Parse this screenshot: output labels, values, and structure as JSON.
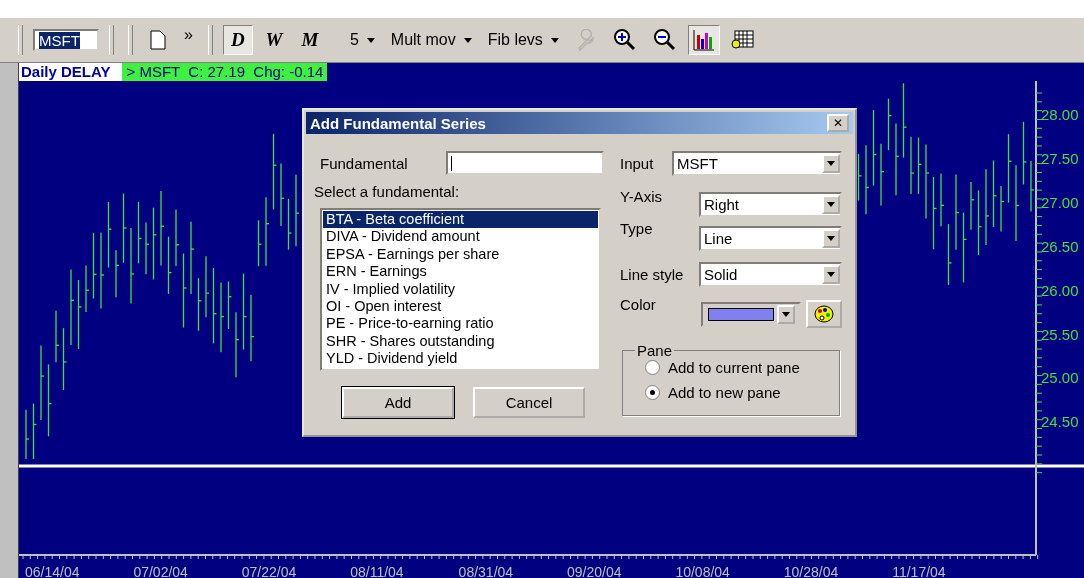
{
  "toolbar": {
    "symbol": "MSFT",
    "overflow": "»",
    "periods": [
      {
        "label": "D",
        "selected": true
      },
      {
        "label": "W",
        "selected": false
      },
      {
        "label": "M",
        "selected": false
      }
    ],
    "dropdowns": [
      {
        "label": "5"
      },
      {
        "label": "Mult mov"
      },
      {
        "label": "Fib levs"
      }
    ],
    "tools": [
      {
        "kind": "wrench",
        "disabled": true,
        "selected": false
      },
      {
        "kind": "zoom-in",
        "disabled": false,
        "selected": false
      },
      {
        "kind": "zoom-out",
        "disabled": false,
        "selected": false
      },
      {
        "kind": "bars",
        "disabled": false,
        "selected": true
      },
      {
        "kind": "grid",
        "disabled": false,
        "selected": false
      }
    ]
  },
  "chart": {
    "title": "Daily DELAY",
    "quote": "> MSFT  C: 27.19  Chg: -0.14",
    "y_labels": [
      "28.00",
      "27.50",
      "27.00",
      "26.50",
      "26.00",
      "25.50",
      "25.00",
      "24.50"
    ],
    "x_labels": [
      "06/14/04",
      "07/02/04",
      "07/22/04",
      "08/11/04",
      "08/31/04",
      "09/20/04",
      "10/08/04",
      "10/28/04",
      "11/17/04"
    ]
  },
  "dialog": {
    "title": "Add Fundamental Series",
    "close": "✕",
    "fundamental_label": "Fundamental",
    "list_label": "Select a fundamental:",
    "items": [
      {
        "label": "BTA - Beta coefficient",
        "selected": true
      },
      {
        "label": "DIVA - Dividend amount",
        "selected": false
      },
      {
        "label": "EPSA - Earnings per share",
        "selected": false
      },
      {
        "label": "ERN - Earnings",
        "selected": false
      },
      {
        "label": "IV - Implied volatility",
        "selected": false
      },
      {
        "label": "OI - Open interest",
        "selected": false
      },
      {
        "label": "PE - Price-to-earning ratio",
        "selected": false
      },
      {
        "label": "SHR - Shares outstanding",
        "selected": false
      },
      {
        "label": "YLD - Dividend yield",
        "selected": false
      }
    ],
    "buttons": [
      {
        "label": "Add",
        "default": true
      },
      {
        "label": "Cancel",
        "default": false
      }
    ],
    "combos": [
      {
        "label": "Input",
        "value": "MSFT"
      },
      {
        "label": "Y-Axis",
        "value": "Right"
      },
      {
        "label": "Type",
        "value": "Line"
      },
      {
        "label": "Line style",
        "value": "Solid"
      }
    ],
    "color": {
      "label": "Color",
      "color": "#8080f0"
    },
    "pane": {
      "label": "Pane",
      "options": [
        {
          "label": "Add to current pane",
          "selected": false
        },
        {
          "label": "Add to new pane",
          "selected": true
        }
      ]
    }
  }
}
